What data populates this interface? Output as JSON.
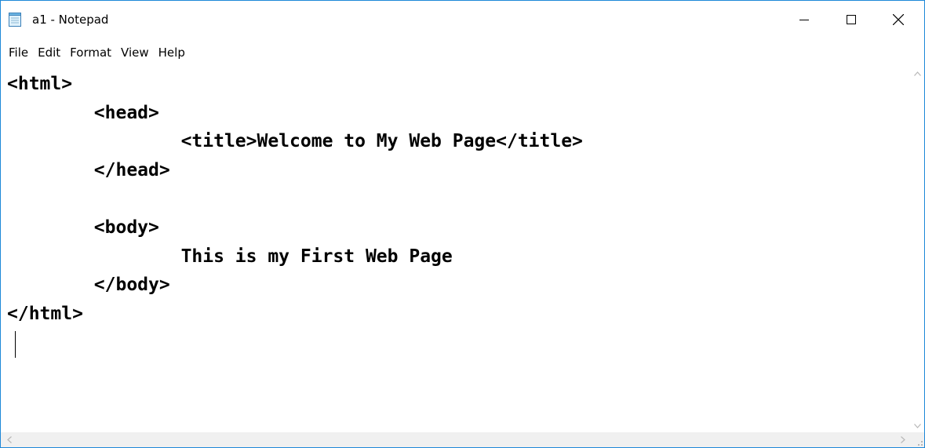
{
  "window": {
    "title": "a1 - Notepad",
    "icon": "notepad-icon",
    "controls": {
      "minimize": "minimize-icon",
      "maximize": "maximize-icon",
      "close": "close-icon"
    }
  },
  "menu": {
    "items": [
      {
        "label": "File"
      },
      {
        "label": "Edit"
      },
      {
        "label": "Format"
      },
      {
        "label": "View"
      },
      {
        "label": "Help"
      }
    ]
  },
  "editor": {
    "content": "<html>\n\t<head>\n\t\t<title>Welcome to My Web Page</title>\n\t</head>\n\n\t<body>\n\t\tThis is my First Web Page\n\t</body>\n</html>",
    "font_weight": "bold"
  },
  "scrollbars": {
    "vertical": {
      "up": "chevron-up-icon",
      "down": "chevron-down-icon"
    },
    "horizontal": {
      "left": "chevron-left-icon",
      "right": "chevron-right-icon"
    }
  },
  "colors": {
    "window_border": "#1e88d8",
    "scroll_arrow": "#b8b8b8",
    "text": "#000000"
  }
}
